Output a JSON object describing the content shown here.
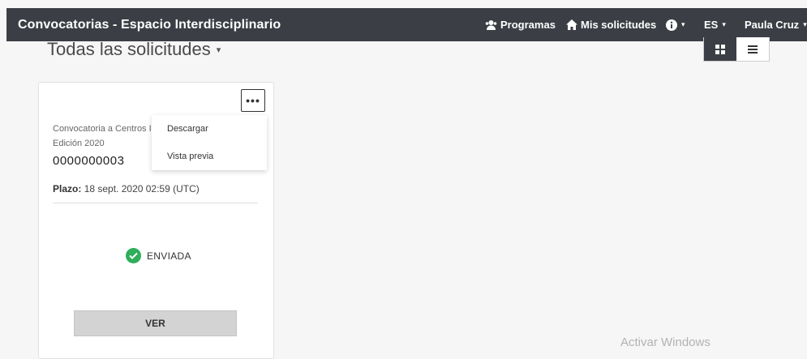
{
  "header": {
    "brand": "Convocatorias - Espacio Interdisciplinario",
    "programs_label": "Programas",
    "my_requests_label": "Mis solicitudes",
    "language": "ES",
    "user": "Paula Cruz",
    "caret": "▾"
  },
  "page": {
    "title": "Todas las solicitudes",
    "title_caret": "▾"
  },
  "card": {
    "more_label": "•••",
    "call_name": "Convocatoria a Centros I",
    "edition": "Edición 2020",
    "number": "0000000003",
    "deadline_label": "Plazo:",
    "deadline_value": "18 sept. 2020 02:59 (UTC)",
    "status": "ENVIADA",
    "view_label": "VER"
  },
  "menu": {
    "items": [
      "Descargar",
      "Vista previa"
    ]
  },
  "watermark": "Activar Windows",
  "colors": {
    "topbar": "#3b3f45",
    "status_ok": "#2fae5b",
    "view_button": "#d3d3d3"
  },
  "icons": {
    "programs": "user-group-icon",
    "my_requests": "home-icon",
    "info": "info-icon",
    "grid_view": "grid-icon",
    "list_view": "list-icon",
    "status": "check-circle-icon"
  }
}
